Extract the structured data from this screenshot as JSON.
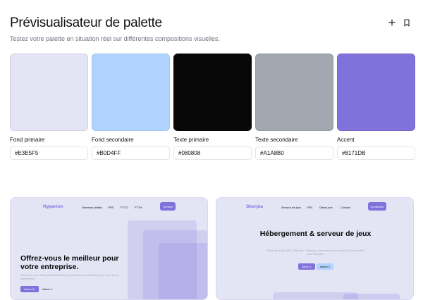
{
  "header": {
    "title": "Prévisualisateur de palette",
    "subtitle": "Testez votre palette en situation réel sur différentes compositions visuelles."
  },
  "icons": {
    "add": "plus-icon",
    "save": "bookmark-icon"
  },
  "swatches": [
    {
      "label": "Fond primaire",
      "hex": "#E3E5F5"
    },
    {
      "label": "Fond secondaire",
      "hex": "#B0D4FF"
    },
    {
      "label": "Texte primaire",
      "hex": "#080808"
    },
    {
      "label": "Texte secondaire",
      "hex": "#A1A8B0"
    },
    {
      "label": "Accent",
      "hex": "#8171DB"
    }
  ],
  "preview_left": {
    "logo": "Hyperion",
    "nav": [
      "Serveurs dédiés",
      "VPS",
      "FTTO",
      "FTTH"
    ],
    "cta": "Contact",
    "title": "Offrez-vous le meilleur pour votre entreprise.",
    "description": "Découvrez nos offres professionnelles performantes et sécurisées pour vos sites et applications.",
    "action1": "Action 01",
    "action2": "Action 2"
  },
  "preview_right": {
    "logo": "Skorpia",
    "nav": [
      "Serveur de jeux",
      "VPS",
      "Game-box",
      "Contact"
    ],
    "cta": "Connexion",
    "title": "Hébergement & serveur de jeux",
    "description": "Minecraft, Rust, ARK, Palworld... déployez votre serveur en moins de 60 secondes chez Skorpia.fr",
    "action1": "Action 1",
    "action2": "Action 2"
  }
}
